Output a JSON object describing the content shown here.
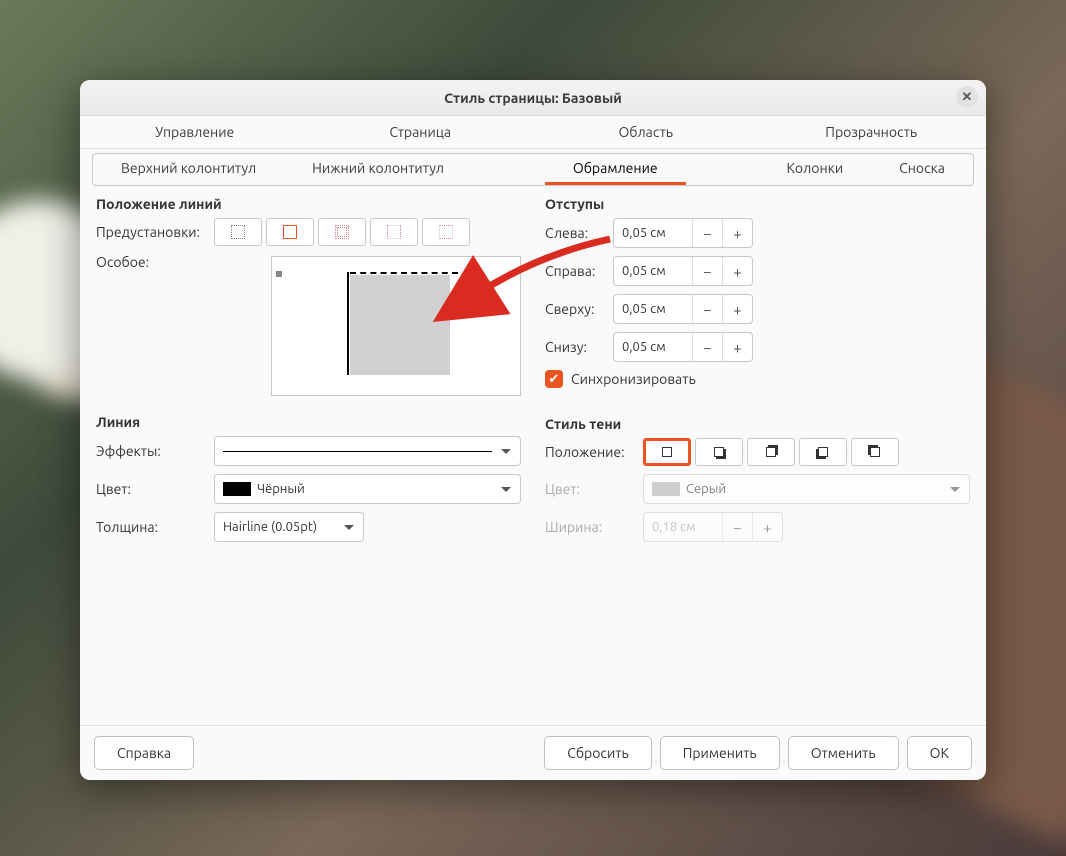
{
  "dialog_title": "Стиль страницы: Базовый",
  "tabs_row1": [
    "Управление",
    "Страница",
    "Область",
    "Прозрачность"
  ],
  "tabs_row2": [
    "Верхний колонтитул",
    "Нижний колонтитул",
    "Обрамление",
    "Колонки",
    "Сноска"
  ],
  "active_tab_row2_index": 2,
  "sections": {
    "line_arrangement": "Положение линий",
    "padding": "Отступы",
    "line": "Линия",
    "shadow": "Стиль тени"
  },
  "labels": {
    "presets": "Предустановки:",
    "custom": "Особое:",
    "left": "Слева:",
    "right": "Справа:",
    "top": "Сверху:",
    "bottom": "Снизу:",
    "sync": "Синхронизировать",
    "effects": "Эффекты:",
    "color": "Цвет:",
    "width": "Толщина:",
    "position": "Положение:",
    "shadow_color": "Цвет:",
    "shadow_width": "Ширина:"
  },
  "values": {
    "pad_left": "0,05 см",
    "pad_right": "0,05 см",
    "pad_top": "0,05 см",
    "pad_bottom": "0,05 см",
    "sync_checked": true,
    "line_color_name": "Чёрный",
    "line_color_hex": "#000000",
    "line_width": "Hairline (0.05pt)",
    "shadow_color_name": "Серый",
    "shadow_color_hex": "#b3b3b3",
    "shadow_width": "0,18 см",
    "shadow_selected_index": 0
  },
  "buttons": {
    "help": "Справка",
    "reset": "Сбросить",
    "apply": "Применить",
    "cancel": "Отменить",
    "ok": "ОК"
  },
  "annotation": {
    "type": "arrow",
    "color": "#d92b1f",
    "target": "custom_preview_top_edge"
  }
}
